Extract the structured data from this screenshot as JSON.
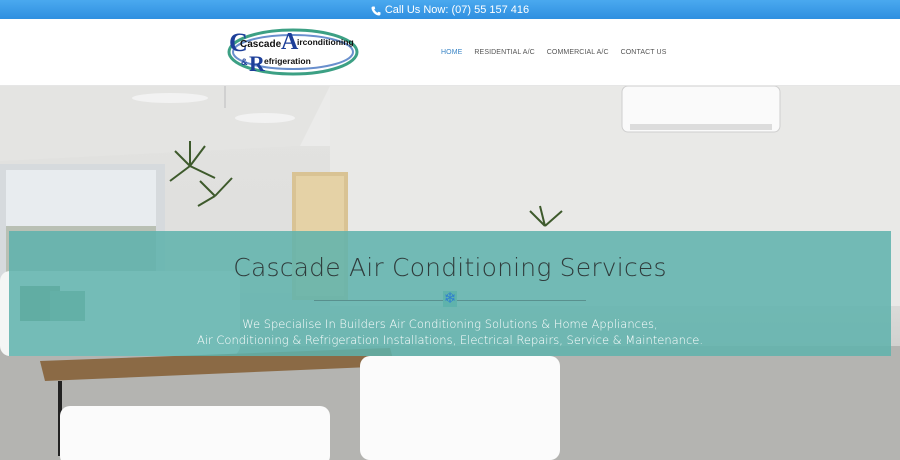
{
  "topbar": {
    "phone_text": "Call Us Now: (07) 55 157 416",
    "icon": "phone-icon"
  },
  "logo": {
    "line1": "Cascade",
    "big_letter_a": "A",
    "line1b": "irconditioning",
    "amp": "&",
    "big_letter_r": "R",
    "line2": "efrigeration",
    "big_letter_c": "C"
  },
  "nav": {
    "items": [
      {
        "label": "HOME",
        "active": true
      },
      {
        "label": "RESIDENTIAL A/C",
        "active": false
      },
      {
        "label": "COMMERCIAL A/C",
        "active": false
      },
      {
        "label": "CONTACT US",
        "active": false
      }
    ]
  },
  "hero": {
    "title": "Cascade Air Conditioning Services",
    "divider_icon": "snowflake-icon",
    "line1": "We Specialise In Builders Air Conditioning Solutions & Home Appliances,",
    "line2": "Air Conditioning & Refrigeration Installations, Electrical Repairs, Service & Maintenance."
  },
  "colors": {
    "topbar": "#3a9ae8",
    "nav_active": "#3a85c6",
    "banner_overlay": "#5eb2ac",
    "accent_icon": "#2f7fd0"
  }
}
